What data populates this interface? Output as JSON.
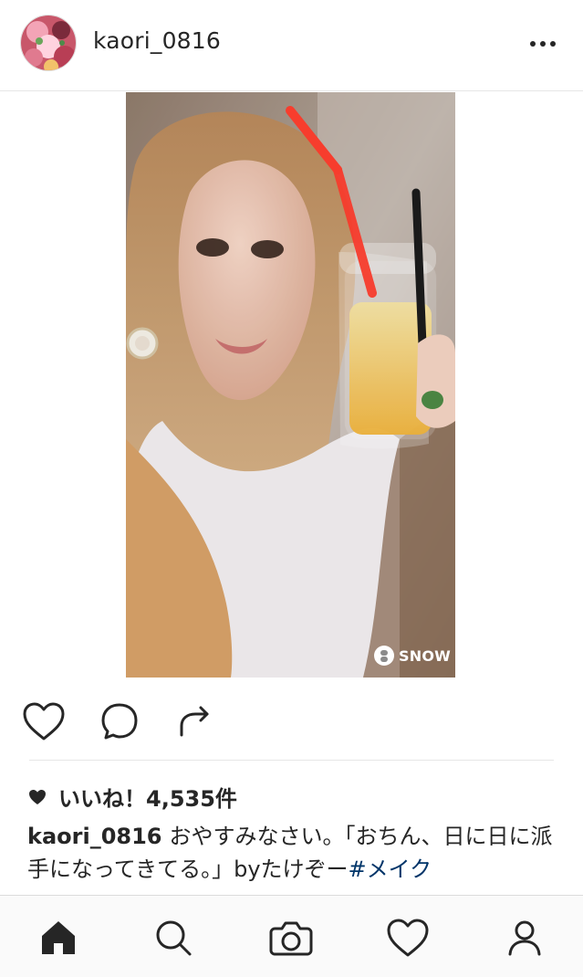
{
  "post": {
    "username": "kaori_0816",
    "watermark": "SNOW",
    "likes_text": "いいね！4,535件",
    "caption_user": "kaori_0816",
    "caption_text": "おやすみなさい。「おちん、日に日に派手になってきてる。」byたけぞー",
    "caption_hashtag": "#メイク"
  },
  "icons": {
    "more": "more-options-icon",
    "like": "heart-icon",
    "comment": "comment-icon",
    "share": "share-icon",
    "likes_heart": "heart-filled-icon",
    "home": "home-icon",
    "search": "search-icon",
    "camera": "camera-icon",
    "activity": "heart-icon",
    "profile": "profile-icon"
  },
  "colors": {
    "text": "#262626",
    "hashtag": "#003569",
    "tabbar_bg": "#fafafa",
    "divider": "#e6e6e6"
  }
}
